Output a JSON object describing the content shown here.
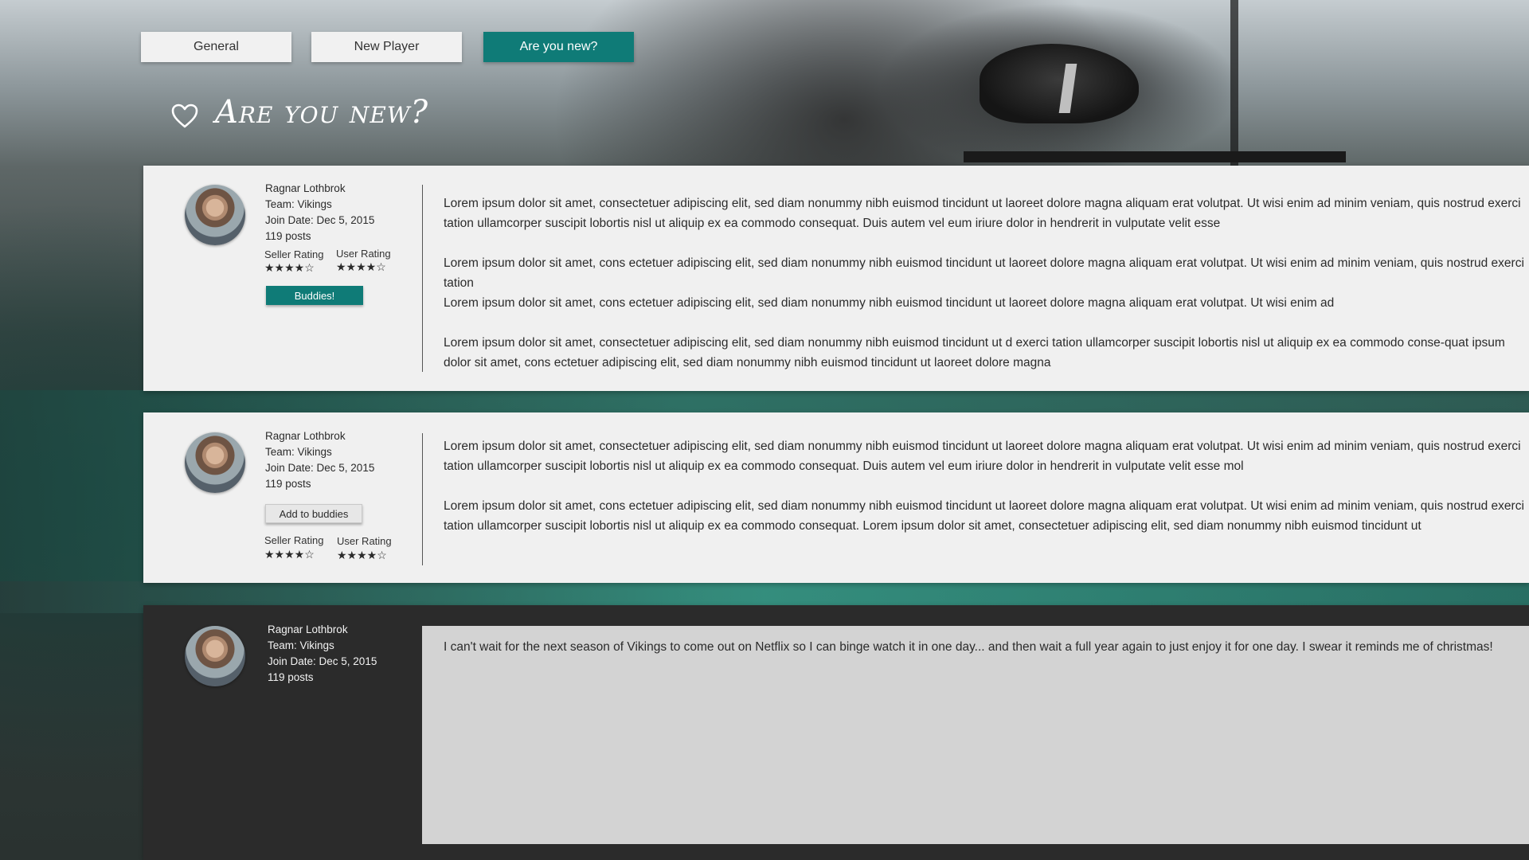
{
  "tabs": [
    {
      "label": "General",
      "active": false
    },
    {
      "label": "New Player",
      "active": false
    },
    {
      "label": "Are you new?",
      "active": true
    }
  ],
  "page_title": "Are you new?",
  "icons": {
    "heading": "heart-outline-icon"
  },
  "colors": {
    "accent": "#0f7b77",
    "card": "#f0f0f0",
    "dark_card": "#2b2b2b",
    "reply_box": "#d3d3d3"
  },
  "posts": [
    {
      "user": {
        "name": "Ragnar Lothbrok",
        "team": "Team: Vikings",
        "join_date": "Join Date: Dec 5, 2015",
        "posts": "119 posts"
      },
      "seller_rating_label": "Seller Rating",
      "user_rating_label": "User Rating",
      "seller_rating": 4.5,
      "user_rating": 4.5,
      "stars": "★★★★☆",
      "button_label": "Buddies!",
      "paragraphs": [
        "Lorem ipsum dolor sit amet, consectetuer adipiscing elit, sed diam nonummy nibh euismod tincidunt ut laoreet dolore magna aliquam erat volutpat. Ut wisi enim ad minim veniam, quis nostrud exerci tation ullamcorper suscipit lobortis nisl ut aliquip ex ea commodo consequat. Duis autem vel eum iriure dolor in hendrerit in vulputate velit esse",
        "Lorem ipsum dolor sit amet, cons ectetuer adipiscing elit, sed diam nonummy nibh euismod tincidunt ut laoreet dolore magna aliquam erat volutpat. Ut wisi enim ad minim veniam, quis nostrud exerci tation",
        "Lorem ipsum dolor sit amet, cons ectetuer adipiscing elit, sed diam nonummy nibh euismod tincidunt ut laoreet dolore magna aliquam erat volutpat. Ut wisi enim ad",
        "Lorem ipsum dolor sit amet, consectetuer adipiscing elit, sed diam nonummy nibh euismod tincidunt ut d exerci tation ullamcorper suscipit lobortis nisl ut aliquip ex ea commodo conse-quat ipsum dolor sit amet, cons ectetuer adipiscing elit, sed diam nonummy nibh euismod tincidunt ut laoreet dolore magna"
      ]
    },
    {
      "user": {
        "name": "Ragnar Lothbrok",
        "team": "Team: Vikings",
        "join_date": "Join Date: Dec 5, 2015",
        "posts": "119 posts"
      },
      "seller_rating_label": "Seller Rating",
      "user_rating_label": "User Rating",
      "seller_rating": 4.5,
      "user_rating": 4.5,
      "stars": "★★★★☆",
      "button_label": "Add to buddies",
      "paragraphs": [
        "Lorem ipsum dolor sit amet, consectetuer adipiscing elit, sed diam nonummy nibh euismod tincidunt ut laoreet dolore magna aliquam erat volutpat. Ut wisi enim ad minim veniam, quis nostrud exerci tation ullamcorper suscipit lobortis nisl ut aliquip ex ea commodo consequat. Duis autem vel eum iriure dolor in hendrerit in vulputate velit esse mol",
        "Lorem ipsum dolor sit amet, cons ectetuer adipiscing elit, sed diam nonummy nibh euismod tincidunt ut laoreet dolore magna aliquam erat volutpat. Ut wisi enim ad minim veniam, quis nostrud exerci tation ullamcorper suscipit lobortis nisl ut aliquip ex ea commodo consequat. Lorem ipsum dolor sit amet, consectetuer adipiscing elit, sed diam nonummy nibh euismod tincidunt ut"
      ]
    },
    {
      "user": {
        "name": "Ragnar Lothbrok",
        "team": "Team: Vikings",
        "join_date": "Join Date: Dec 5, 2015",
        "posts": "119 posts"
      },
      "reply_text": "I can't wait for the next season of Vikings to come out on Netflix so I can binge watch it in one day... and then wait a full year again to just enjoy it for one day. I swear it reminds me of christmas!"
    }
  ]
}
